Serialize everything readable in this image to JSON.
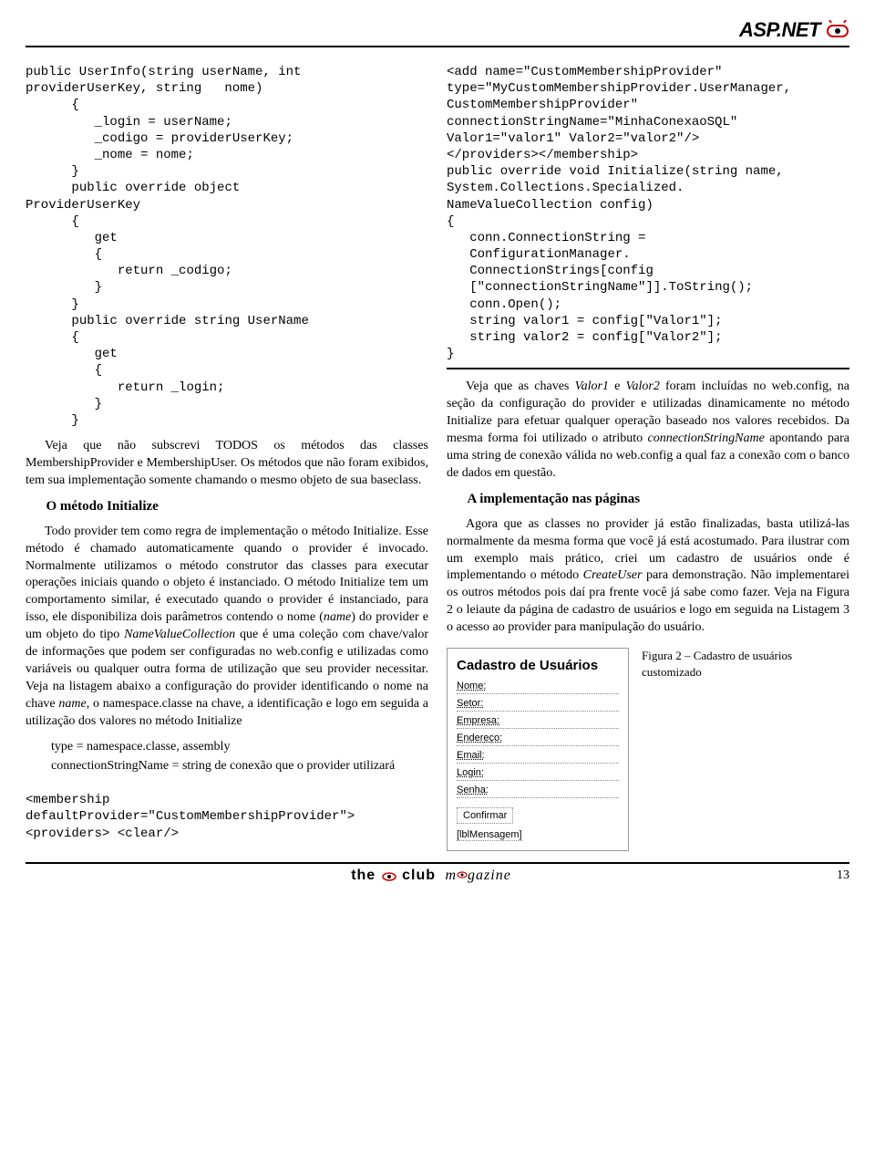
{
  "header": {
    "label": "ASP.NET"
  },
  "left": {
    "code1": "public UserInfo(string userName, int\nproviderUserKey, string   nome)\n      {\n         _login = userName;\n         _codigo = providerUserKey;\n         _nome = nome;\n      }\n      public override object\nProviderUserKey\n      {\n         get\n         {\n            return _codigo;\n         }\n      }\n      public override string UserName\n      {\n         get\n         {\n            return _login;\n         }\n      }",
    "p1": "Veja que não subscrevi TODOS os métodos das classes MembershipProvider e MembershipUser. Os métodos que não foram exibidos, tem sua implementação somente chamando o mesmo objeto de sua baseclass.",
    "h1": "O método Initialize",
    "p2a": "Todo provider tem como regra de implementação o método Initialize. Esse método é chamado automaticamente quando o provider é invocado. Normalmente utilizamos o método construtor das classes para executar operações iniciais quando o objeto é instanciado. O método Initialize tem um comportamento similar, é executado quando o provider é instanciado, para isso, ele disponibiliza dois parâmetros contendo o nome (",
    "p2b": ") do provider e um objeto do tipo ",
    "p2c": " que é uma coleção com chave/valor de informações que podem ser configuradas no web.config e utilizadas como variáveis ou qualquer outra forma de utilização que seu provider necessitar. Veja na listagem abaixo a configuração do provider identificando o nome na chave ",
    "p2d": ", o namespace.classe na chave, a identificação e logo em seguida a utilização dos valores no método Initialize",
    "italic_name": "name",
    "italic_nvc": "NameValueCollection",
    "italic_name2": "name",
    "l1": "type = namespace.classe, assembly",
    "l2": "connectionStringName = string de conexão que o provider utilizará",
    "code_bottom": "<membership\ndefaultProvider=\"CustomMembershipProvider\">\n<providers> <clear/>"
  },
  "right": {
    "code1": "<add name=\"CustomMembershipProvider\"\ntype=\"MyCustomMembershipProvider.UserManager,\nCustomMembershipProvider\"\nconnectionStringName=\"MinhaConexaoSQL\"\nValor1=\"valor1\" Valor2=\"valor2\"/>\n</providers></membership>\npublic override void Initialize(string name,\nSystem.Collections.Specialized.\nNameValueCollection config)\n{\n   conn.ConnectionString =\n   ConfigurationManager.\n   ConnectionStrings[config\n   [\"connectionStringName\"]].ToString();\n   conn.Open();\n   string valor1 = config[\"Valor1\"];\n   string valor2 = config[\"Valor2\"];\n}",
    "p1a": "Veja que as chaves ",
    "p1b": " e ",
    "p1c": " foram incluídas no web.config, na seção da configuração do provider e utilizadas dinamicamente no método Initialize para efetuar qualquer operação baseado nos valores recebidos. Da mesma forma foi utilizado o atributo ",
    "p1d": " apontando para uma string de conexão válida no web.config a qual faz a conexão com o banco de dados em questão.",
    "italic_v1": "Valor1",
    "italic_v2": "Valor2",
    "italic_csn": "connectionStringName",
    "h2": "A implementação nas páginas",
    "p2a": "Agora que as classes no provider já estão finalizadas, basta utilizá-las normalmente da mesma forma que você já está acostumado. Para ilustrar com um exemplo mais prático, criei um cadastro de usuários onde é implementando o método ",
    "p2b": " para demonstração. Não implementarei os outros métodos pois daí pra frente você já sabe como fazer. Veja na Figura 2 o leiaute da página de cadastro de usuários e logo em seguida na Listagem 3 o acesso ao provider para manipulação do usuário.",
    "italic_cu": "CreateUser",
    "form": {
      "title": "Cadastro de Usuários",
      "rows": [
        "Nome:",
        "Setor:",
        "Empresa:",
        "Endereço:",
        "Email:",
        "Login:",
        "Senha:"
      ],
      "button": "Confirmar",
      "msg": "[lblMensagem]"
    },
    "caption": "Figura 2 – Cadastro de usuários customizado"
  },
  "footer": {
    "brand_the": "the",
    "brand_club": "club",
    "brand_mag": "megazine",
    "page": "13"
  }
}
